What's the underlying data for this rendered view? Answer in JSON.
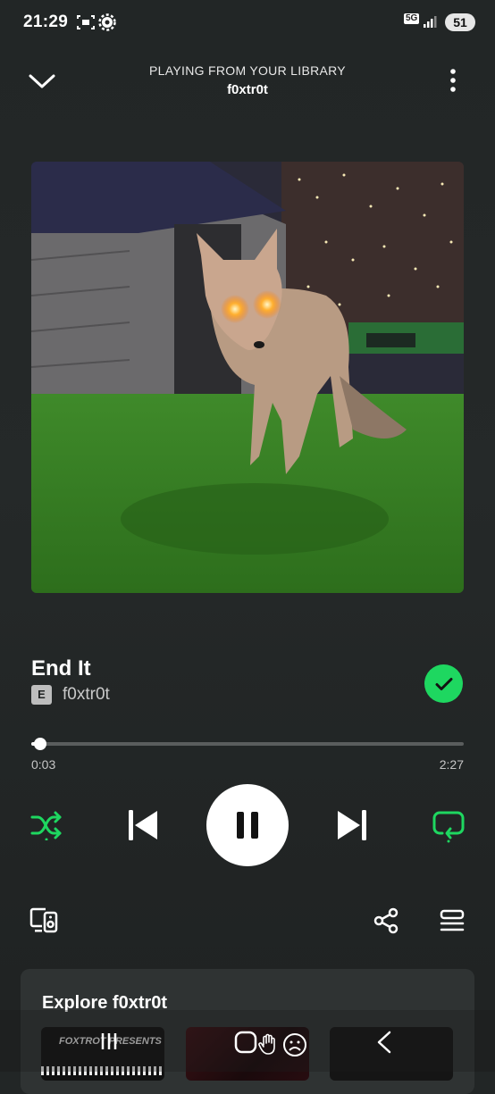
{
  "status_bar": {
    "time": "21:29",
    "network": "5G",
    "battery": "51"
  },
  "header": {
    "context_label": "PLAYING FROM YOUR LIBRARY",
    "context_name": "f0xtr0t"
  },
  "artwork": {
    "icon": "album-art-fox-image"
  },
  "track": {
    "title": "End It",
    "explicit_badge": "E",
    "artist": "f0xtr0t",
    "liked": true
  },
  "progress": {
    "current": "0:03",
    "total": "2:27",
    "fraction": 0.02
  },
  "controls": {
    "shuffle_on": true,
    "repeat_on": true,
    "state": "playing"
  },
  "explore": {
    "title": "Explore f0xtr0t",
    "cards": [
      {
        "caption": "FOXTROT PRESENTS"
      }
    ]
  },
  "colors": {
    "accent": "#1ed760",
    "background": "#232727"
  }
}
